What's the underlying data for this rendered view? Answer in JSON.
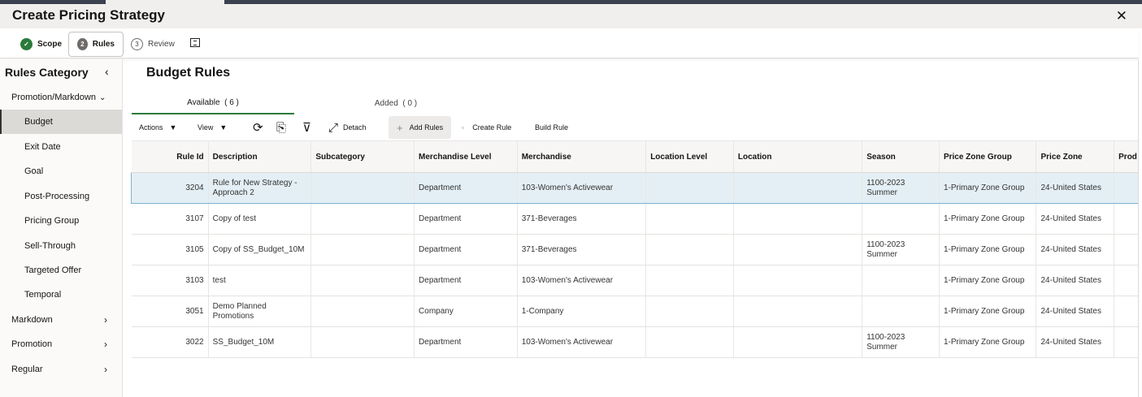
{
  "header": {
    "title": "Create Pricing Strategy",
    "close_glyph": "✕"
  },
  "steps": [
    {
      "label": "Scope",
      "marker": "✓"
    },
    {
      "label": "Rules",
      "marker": "2"
    },
    {
      "label": "Review",
      "marker": "3"
    }
  ],
  "sidebar": {
    "title": "Rules Category",
    "collapse_glyph": "‹",
    "items": [
      {
        "label": "Promotion/Markdown",
        "glyph": "⌄"
      },
      {
        "label": "Budget"
      },
      {
        "label": "Exit Date"
      },
      {
        "label": "Goal"
      },
      {
        "label": "Post-Processing"
      },
      {
        "label": "Pricing Group"
      },
      {
        "label": "Sell-Through"
      },
      {
        "label": "Targeted Offer"
      },
      {
        "label": "Temporal"
      },
      {
        "label": "Markdown",
        "glyph": "›"
      },
      {
        "label": "Promotion",
        "glyph": "›"
      },
      {
        "label": "Regular",
        "glyph": "›"
      }
    ]
  },
  "main": {
    "title": "Budget Rules",
    "tabs": [
      {
        "label": "Available",
        "count": "( 6 )"
      },
      {
        "label": "Added",
        "count": "( 0 )"
      }
    ],
    "toolbar": {
      "actions": "Actions",
      "view": "View",
      "caret": "▼",
      "refresh_glyph": "⟳",
      "export_glyph": "⎘",
      "filter_glyph": "⊽",
      "detach_glyph": "⤢",
      "detach": "Detach",
      "add_glyph": "+",
      "add_rules": "Add Rules",
      "create_glyph": "▫",
      "create_rule": "Create Rule",
      "build_rule": "Build Rule"
    }
  },
  "table": {
    "columns": [
      "Rule Id",
      "Description",
      "Subcategory",
      "Merchandise Level",
      "Merchandise",
      "Location Level",
      "Location",
      "Season",
      "Price Zone Group",
      "Price Zone",
      "Prod"
    ],
    "rows": [
      [
        "3204",
        "Rule for New Strategy - Approach 2",
        "",
        "Department",
        "103-Women's Activewear",
        "",
        "",
        "1100-2023 Summer",
        "1-Primary Zone Group",
        "24-United States",
        ""
      ],
      [
        "3107",
        "Copy of test",
        "",
        "Department",
        "371-Beverages",
        "",
        "",
        "",
        "1-Primary Zone Group",
        "24-United States",
        ""
      ],
      [
        "3105",
        "Copy of SS_Budget_10M",
        "",
        "Department",
        "371-Beverages",
        "",
        "",
        "1100-2023 Summer",
        "1-Primary Zone Group",
        "24-United States",
        ""
      ],
      [
        "3103",
        "test",
        "",
        "Department",
        "103-Women's Activewear",
        "",
        "",
        "",
        "1-Primary Zone Group",
        "24-United States",
        ""
      ],
      [
        "3051",
        "Demo Planned Promotions",
        "",
        "Company",
        "1-Company",
        "",
        "",
        "",
        "1-Primary Zone Group",
        "24-United States",
        ""
      ],
      [
        "3022",
        "SS_Budget_10M",
        "",
        "Department",
        "103-Women's Activewear",
        "",
        "",
        "1100-2023 Summer",
        "1-Primary Zone Group",
        "24-United States",
        ""
      ]
    ]
  }
}
